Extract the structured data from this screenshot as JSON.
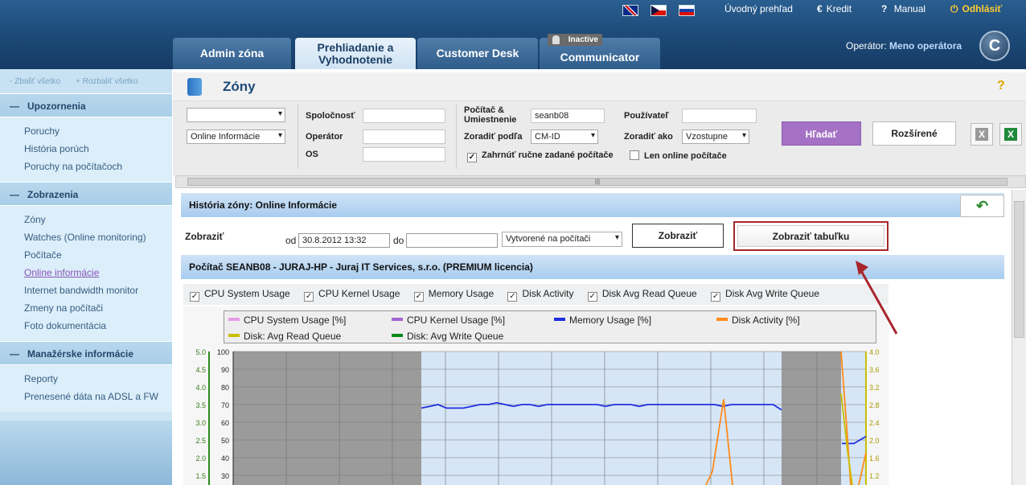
{
  "top_links": {
    "overview": "Úvodný prehľad",
    "credit": "Kredit",
    "manual": "Manual",
    "logout": "Odhlásiť"
  },
  "tabs": [
    {
      "label": "Admin zóna"
    },
    {
      "label": "Prehliadanie a Vyhodnotenie"
    },
    {
      "label": "Customer Desk"
    },
    {
      "label": "Communicator",
      "badge": "Inactive"
    }
  ],
  "operator": {
    "label": "Operátor:",
    "name": "Meno operátora"
  },
  "logo_letter": "C",
  "sidebar": {
    "collapse_all": "- Zbaliť všetko",
    "expand_all": "+ Rozbaliť všetko",
    "groups": [
      {
        "title": "Upozornenia",
        "items": [
          "Poruchy",
          "História porúch",
          "Poruchy na počítačoch"
        ]
      },
      {
        "title": "Zobrazenia",
        "items": [
          "Zóny",
          "Watches (Online monitoring)",
          "Počítače",
          "Online informácie",
          "Internet bandwidth monitor",
          "Zmeny na počítači",
          "Foto dokumentácia"
        ]
      },
      {
        "title": "Manažérske informácie",
        "items": [
          "Reporty",
          "Prenesené dáta na ADSL a FW"
        ]
      }
    ]
  },
  "page": {
    "title": "Zóny",
    "help": "?"
  },
  "filters": {
    "select1": "",
    "select2": "Online Informácie",
    "company_label": "Spoločnosť",
    "operator_label": "Operátor",
    "os_label": "OS",
    "pc_label": "Počítač & Umiestnenie",
    "pc_value": "seanb08",
    "sort_by_label": "Zoradiť podľa",
    "sort_by_value": "CM-ID",
    "user_label": "Používateľ",
    "sort_as_label": "Zoradiť ako",
    "sort_as_value": "Vzostupne",
    "manual_pcs": "Zahrnúť ručne zadané počítače",
    "online_only": "Len online počítače",
    "search_btn": "Hľadať",
    "advanced_btn": "Rozšírené"
  },
  "history": {
    "title": "História zóny: Online Informácie",
    "show_label": "Zobraziť",
    "from_label": "od",
    "from_value": "30.8.2012 13:32",
    "to_label": "do",
    "to_value": "",
    "mode": "Vytvorené na počítači",
    "show_btn": "Zobraziť",
    "show_table_btn": "Zobraziť tabuľku"
  },
  "pc_title": "Počítač SEANB08 - JURAJ-HP - Juraj IT Services, s.r.o. (PREMIUM licencia)",
  "series_checks": [
    "CPU System Usage",
    "CPU Kernel Usage",
    "Memory Usage",
    "Disk Activity",
    "Disk Avg Read Queue",
    "Disk Avg Write Queue"
  ],
  "chart_data": {
    "type": "line",
    "legend": [
      {
        "name": "CPU System Usage [%]",
        "color": "#e59ae8"
      },
      {
        "name": "CPU Kernel Usage [%]",
        "color": "#a366d6"
      },
      {
        "name": "Memory Usage [%]",
        "color": "#1f2fe0"
      },
      {
        "name": "Disk Activity [%]",
        "color": "#ff8a1a"
      },
      {
        "name": "Disk: Avg Read Queue",
        "color": "#c8c000"
      },
      {
        "name": "Disk: Avg Write Queue",
        "color": "#0a8a1a"
      }
    ],
    "y_left1_ticks": [
      "5.0",
      "4.5",
      "4.0",
      "3.5",
      "3.0",
      "2.5",
      "2.0",
      "1.5"
    ],
    "y_left2_ticks": [
      "100",
      "90",
      "80",
      "70",
      "60",
      "50",
      "40",
      "30"
    ],
    "y_right_ticks": [
      "4.0",
      "3.6",
      "3.2",
      "2.8",
      "2.4",
      "2.0",
      "1.6",
      "1.2"
    ],
    "memory_usage": [
      68,
      69,
      70,
      68,
      68,
      68,
      69,
      70,
      70,
      71,
      70,
      69,
      70,
      70,
      69,
      70,
      70,
      70,
      70,
      70,
      70,
      70,
      69,
      70,
      70,
      70,
      69,
      70,
      70,
      70,
      70,
      70,
      70,
      70,
      70,
      70,
      69,
      70,
      70,
      70,
      70,
      70,
      70,
      67
    ],
    "memory_usage_tail": [
      48,
      48,
      52
    ],
    "disk_activity_spike": 73
  }
}
